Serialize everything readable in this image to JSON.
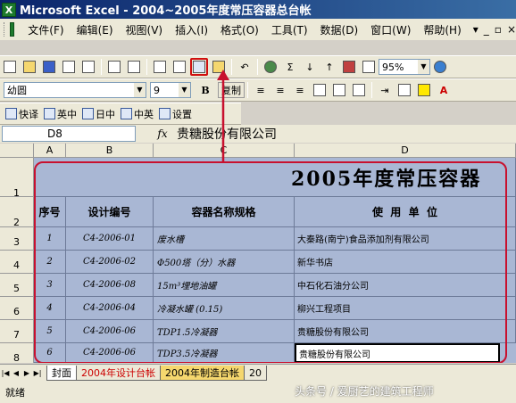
{
  "window": {
    "title": "Microsoft Excel - 2004~2005年度常压容器总台帐"
  },
  "menu": {
    "items": [
      "文件(F)",
      "编辑(E)",
      "视图(V)",
      "插入(I)",
      "格式(O)",
      "工具(T)",
      "数据(D)",
      "窗口(W)",
      "帮助(H)"
    ],
    "controls": [
      "▾",
      "_",
      "▫",
      "×"
    ]
  },
  "toolbar": {
    "zoom": "95%",
    "font": "幼圆",
    "size": "9",
    "bold": "B",
    "copy_label": "复制"
  },
  "translate_bar": {
    "buttons": [
      "快译",
      "英中",
      "日中",
      "中英",
      "设置"
    ]
  },
  "formula_bar": {
    "cell": "D8",
    "fx": "fx",
    "value": "贵糖股份有限公司"
  },
  "sheet": {
    "col_headers": [
      "A",
      "B",
      "C",
      "D"
    ],
    "row_headers": [
      "1",
      "2",
      "3",
      "4",
      "5",
      "6",
      "7",
      "8"
    ],
    "title": "2005年度常压容器",
    "headers": [
      "序号",
      "设计编号",
      "容器名称规格",
      "使  用  单  位"
    ],
    "rows": [
      [
        "1",
        "C4-2006-01",
        "废水槽",
        "大秦路(南宁)食品添加剂有限公司"
      ],
      [
        "2",
        "C4-2006-02",
        "Φ500塔（分）水器",
        "新华书店"
      ],
      [
        "3",
        "C4-2006-08",
        "15m³埋地油罐",
        "中石化石油分公司"
      ],
      [
        "4",
        "C4-2006-04",
        "冷凝水罐 (0.15)",
        "柳兴工程项目"
      ],
      [
        "5",
        "C4-2006-06",
        "TDP1.5冷凝器",
        "贵糖股份有限公司"
      ],
      [
        "6",
        "C4-2006-06",
        "TDP3.5冷凝器",
        "贵糖股份有限公司"
      ]
    ]
  },
  "sheet_tabs": [
    "封面",
    "2004年设计台帐",
    "2004年制造台帐",
    "20"
  ],
  "status": {
    "text": "就绪"
  },
  "watermark": "头条号 / 爱厨艺的建筑工程师"
}
